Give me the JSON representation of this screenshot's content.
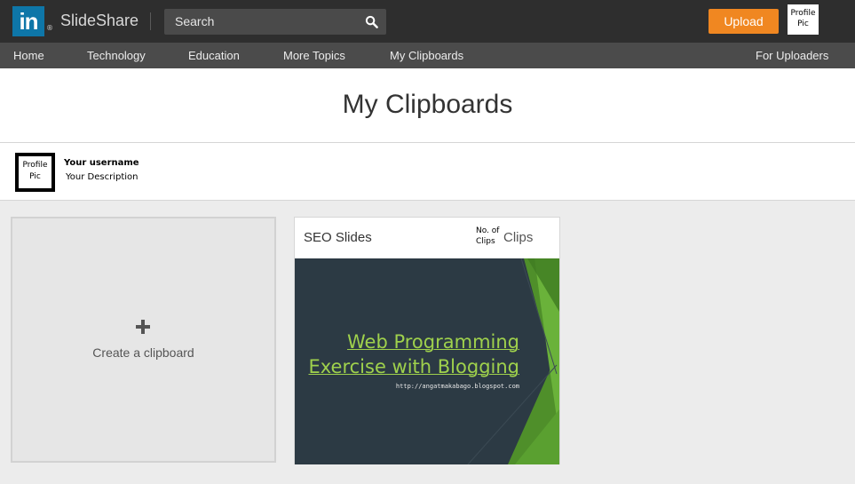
{
  "header": {
    "logo_text": "in",
    "logo_registered": "®",
    "brand": "SlideShare",
    "search_label": "Search",
    "upload_label": "Upload",
    "profile_pic_label_line1": "Profile",
    "profile_pic_label_line2": "Pic"
  },
  "nav": {
    "items": [
      "Home",
      "Technology",
      "Education",
      "More Topics",
      "My Clipboards"
    ],
    "right_item": "For Uploaders"
  },
  "page": {
    "title": "My Clipboards"
  },
  "user": {
    "pic_line1": "Profile",
    "pic_line2": "Pic",
    "username": "Your username",
    "description": "Your Description"
  },
  "create_card": {
    "label": "Create a clipboard"
  },
  "clipboards": [
    {
      "title": "SEO Slides",
      "count_line1": "No. of",
      "count_line2": "Clips",
      "clips_word": "Clips",
      "thumb_line1": "Web Programming",
      "thumb_line2": "Exercise with Blogging",
      "thumb_url": "http://angatmakabago.blogspot.com"
    }
  ],
  "colors": {
    "topbar": "#2e2e2e",
    "navbar": "#4b4b4b",
    "accent_upload": "#f08721",
    "logo_blue": "#0e76a8",
    "thumb_green": "#9fd14c"
  }
}
